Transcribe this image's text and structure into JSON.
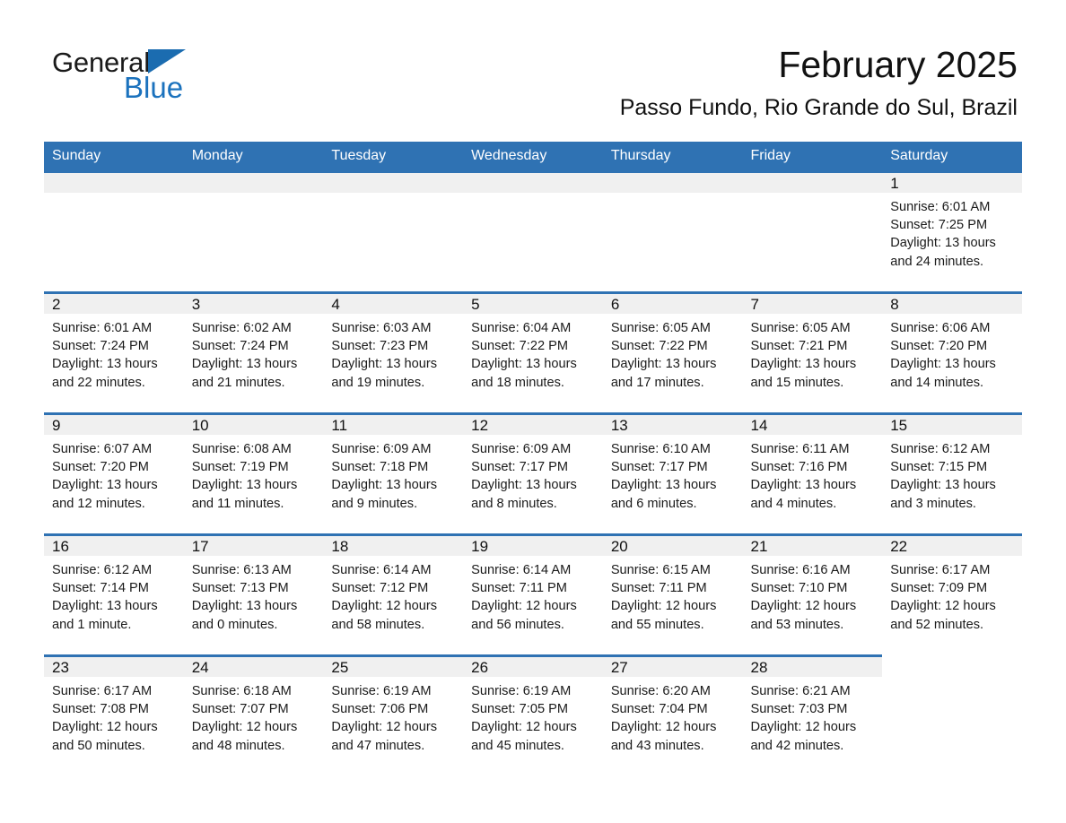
{
  "brand": {
    "name_part1": "General",
    "name_part2": "Blue",
    "triangle_icon": "triangle-icon",
    "colors": {
      "black": "#1a1a1a",
      "blue": "#1b72bd"
    }
  },
  "header": {
    "title": "February 2025",
    "subtitle": "Passo Fundo, Rio Grande do Sul, Brazil"
  },
  "calendar": {
    "header_color": "#2f72b3",
    "band_color": "#f0f0f0",
    "weekdays": [
      "Sunday",
      "Monday",
      "Tuesday",
      "Wednesday",
      "Thursday",
      "Friday",
      "Saturday"
    ],
    "weeks": [
      [
        {
          "day": "",
          "state": "empty",
          "sunrise": "",
          "sunset": "",
          "daylight": ""
        },
        {
          "day": "",
          "state": "empty",
          "sunrise": "",
          "sunset": "",
          "daylight": ""
        },
        {
          "day": "",
          "state": "empty",
          "sunrise": "",
          "sunset": "",
          "daylight": ""
        },
        {
          "day": "",
          "state": "empty",
          "sunrise": "",
          "sunset": "",
          "daylight": ""
        },
        {
          "day": "",
          "state": "empty",
          "sunrise": "",
          "sunset": "",
          "daylight": ""
        },
        {
          "day": "",
          "state": "empty",
          "sunrise": "",
          "sunset": "",
          "daylight": ""
        },
        {
          "day": "1",
          "state": "filled",
          "sunrise": "Sunrise: 6:01 AM",
          "sunset": "Sunset: 7:25 PM",
          "daylight": "Daylight: 13 hours and 24 minutes."
        }
      ],
      [
        {
          "day": "2",
          "state": "filled",
          "sunrise": "Sunrise: 6:01 AM",
          "sunset": "Sunset: 7:24 PM",
          "daylight": "Daylight: 13 hours and 22 minutes."
        },
        {
          "day": "3",
          "state": "filled",
          "sunrise": "Sunrise: 6:02 AM",
          "sunset": "Sunset: 7:24 PM",
          "daylight": "Daylight: 13 hours and 21 minutes."
        },
        {
          "day": "4",
          "state": "filled",
          "sunrise": "Sunrise: 6:03 AM",
          "sunset": "Sunset: 7:23 PM",
          "daylight": "Daylight: 13 hours and 19 minutes."
        },
        {
          "day": "5",
          "state": "filled",
          "sunrise": "Sunrise: 6:04 AM",
          "sunset": "Sunset: 7:22 PM",
          "daylight": "Daylight: 13 hours and 18 minutes."
        },
        {
          "day": "6",
          "state": "filled",
          "sunrise": "Sunrise: 6:05 AM",
          "sunset": "Sunset: 7:22 PM",
          "daylight": "Daylight: 13 hours and 17 minutes."
        },
        {
          "day": "7",
          "state": "filled",
          "sunrise": "Sunrise: 6:05 AM",
          "sunset": "Sunset: 7:21 PM",
          "daylight": "Daylight: 13 hours and 15 minutes."
        },
        {
          "day": "8",
          "state": "filled",
          "sunrise": "Sunrise: 6:06 AM",
          "sunset": "Sunset: 7:20 PM",
          "daylight": "Daylight: 13 hours and 14 minutes."
        }
      ],
      [
        {
          "day": "9",
          "state": "filled",
          "sunrise": "Sunrise: 6:07 AM",
          "sunset": "Sunset: 7:20 PM",
          "daylight": "Daylight: 13 hours and 12 minutes."
        },
        {
          "day": "10",
          "state": "filled",
          "sunrise": "Sunrise: 6:08 AM",
          "sunset": "Sunset: 7:19 PM",
          "daylight": "Daylight: 13 hours and 11 minutes."
        },
        {
          "day": "11",
          "state": "filled",
          "sunrise": "Sunrise: 6:09 AM",
          "sunset": "Sunset: 7:18 PM",
          "daylight": "Daylight: 13 hours and 9 minutes."
        },
        {
          "day": "12",
          "state": "filled",
          "sunrise": "Sunrise: 6:09 AM",
          "sunset": "Sunset: 7:17 PM",
          "daylight": "Daylight: 13 hours and 8 minutes."
        },
        {
          "day": "13",
          "state": "filled",
          "sunrise": "Sunrise: 6:10 AM",
          "sunset": "Sunset: 7:17 PM",
          "daylight": "Daylight: 13 hours and 6 minutes."
        },
        {
          "day": "14",
          "state": "filled",
          "sunrise": "Sunrise: 6:11 AM",
          "sunset": "Sunset: 7:16 PM",
          "daylight": "Daylight: 13 hours and 4 minutes."
        },
        {
          "day": "15",
          "state": "filled",
          "sunrise": "Sunrise: 6:12 AM",
          "sunset": "Sunset: 7:15 PM",
          "daylight": "Daylight: 13 hours and 3 minutes."
        }
      ],
      [
        {
          "day": "16",
          "state": "filled",
          "sunrise": "Sunrise: 6:12 AM",
          "sunset": "Sunset: 7:14 PM",
          "daylight": "Daylight: 13 hours and 1 minute."
        },
        {
          "day": "17",
          "state": "filled",
          "sunrise": "Sunrise: 6:13 AM",
          "sunset": "Sunset: 7:13 PM",
          "daylight": "Daylight: 13 hours and 0 minutes."
        },
        {
          "day": "18",
          "state": "filled",
          "sunrise": "Sunrise: 6:14 AM",
          "sunset": "Sunset: 7:12 PM",
          "daylight": "Daylight: 12 hours and 58 minutes."
        },
        {
          "day": "19",
          "state": "filled",
          "sunrise": "Sunrise: 6:14 AM",
          "sunset": "Sunset: 7:11 PM",
          "daylight": "Daylight: 12 hours and 56 minutes."
        },
        {
          "day": "20",
          "state": "filled",
          "sunrise": "Sunrise: 6:15 AM",
          "sunset": "Sunset: 7:11 PM",
          "daylight": "Daylight: 12 hours and 55 minutes."
        },
        {
          "day": "21",
          "state": "filled",
          "sunrise": "Sunrise: 6:16 AM",
          "sunset": "Sunset: 7:10 PM",
          "daylight": "Daylight: 12 hours and 53 minutes."
        },
        {
          "day": "22",
          "state": "filled",
          "sunrise": "Sunrise: 6:17 AM",
          "sunset": "Sunset: 7:09 PM",
          "daylight": "Daylight: 12 hours and 52 minutes."
        }
      ],
      [
        {
          "day": "23",
          "state": "filled",
          "sunrise": "Sunrise: 6:17 AM",
          "sunset": "Sunset: 7:08 PM",
          "daylight": "Daylight: 12 hours and 50 minutes."
        },
        {
          "day": "24",
          "state": "filled",
          "sunrise": "Sunrise: 6:18 AM",
          "sunset": "Sunset: 7:07 PM",
          "daylight": "Daylight: 12 hours and 48 minutes."
        },
        {
          "day": "25",
          "state": "filled",
          "sunrise": "Sunrise: 6:19 AM",
          "sunset": "Sunset: 7:06 PM",
          "daylight": "Daylight: 12 hours and 47 minutes."
        },
        {
          "day": "26",
          "state": "filled",
          "sunrise": "Sunrise: 6:19 AM",
          "sunset": "Sunset: 7:05 PM",
          "daylight": "Daylight: 12 hours and 45 minutes."
        },
        {
          "day": "27",
          "state": "filled",
          "sunrise": "Sunrise: 6:20 AM",
          "sunset": "Sunset: 7:04 PM",
          "daylight": "Daylight: 12 hours and 43 minutes."
        },
        {
          "day": "28",
          "state": "filled",
          "sunrise": "Sunrise: 6:21 AM",
          "sunset": "Sunset: 7:03 PM",
          "daylight": "Daylight: 12 hours and 42 minutes."
        },
        {
          "day": "",
          "state": "blank",
          "sunrise": "",
          "sunset": "",
          "daylight": ""
        }
      ]
    ]
  }
}
